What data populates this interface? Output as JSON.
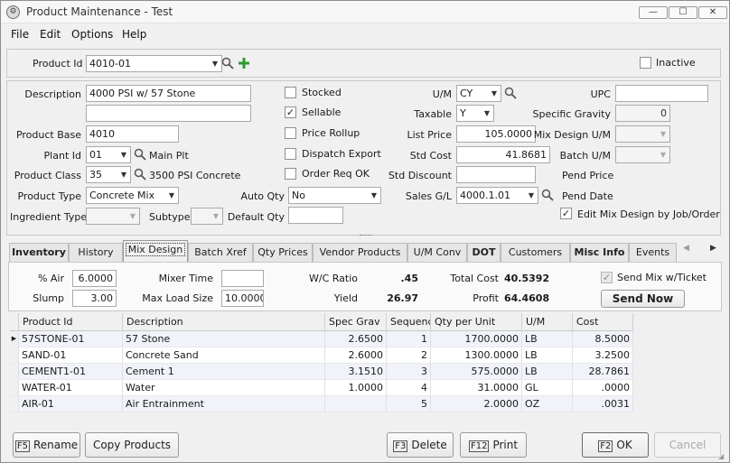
{
  "window": {
    "title": "Product Maintenance - Test",
    "min_glyph": "—",
    "max_glyph": "☐",
    "close_glyph": "✕"
  },
  "menu": [
    "File",
    "Edit",
    "Options",
    "Help"
  ],
  "product_header": {
    "product_id_label": "Product Id",
    "product_id_value": "4010-01",
    "inactive_label": "Inactive",
    "inactive_checked": false
  },
  "details": {
    "description_label": "Description",
    "description_value": "4000 PSI w/ 57 Stone",
    "description2_value": "",
    "product_base_label": "Product Base",
    "product_base_value": "4010",
    "plant_id_label": "Plant Id",
    "plant_id_value": "01",
    "plant_name": "Main Plt",
    "product_class_label": "Product Class",
    "product_class_value": "35",
    "product_class_name": "3500 PSI Concrete",
    "product_type_label": "Product Type",
    "product_type_value": "Concrete Mix",
    "ingredient_type_label": "Ingredient Type",
    "ingredient_type_value": "",
    "subtype_label": "Subtype",
    "subtype_value": "",
    "auto_qty_label": "Auto Qty",
    "auto_qty_value": "No",
    "default_qty_label": "Default Qty",
    "default_qty_value": ""
  },
  "flags": {
    "stocked_label": "Stocked",
    "stocked": false,
    "sellable_label": "Sellable",
    "sellable": true,
    "price_rollup_label": "Price Rollup",
    "price_rollup": false,
    "dispatch_export_label": "Dispatch Export",
    "dispatch_export": false,
    "order_req_ok_label": "Order Req OK",
    "order_req_ok": false
  },
  "pricing": {
    "um_label": "U/M",
    "um_value": "CY",
    "taxable_label": "Taxable",
    "taxable_value": "Y",
    "list_price_label": "List Price",
    "list_price_value": "105.0000",
    "std_cost_label": "Std Cost",
    "std_cost_value": "41.8681",
    "std_discount_label": "Std Discount",
    "std_discount_value": "",
    "sales_gl_label": "Sales G/L",
    "sales_gl_value": "4000.1.01"
  },
  "right_col": {
    "upc_label": "UPC",
    "upc_value": "",
    "specific_gravity_label": "Specific Gravity",
    "specific_gravity_value": "0",
    "mix_design_um_label": "Mix Design U/M",
    "mix_design_um_value": "",
    "batch_um_label": "Batch U/M",
    "batch_um_value": "",
    "pend_price_label": "Pend Price",
    "pend_date_label": "Pend Date",
    "edit_mix_label": "Edit Mix Design by Job/Order",
    "edit_mix": true
  },
  "tabs": [
    "Inventory",
    "History",
    "Mix Design",
    "Batch Xref",
    "Qty Prices",
    "Vendor Products",
    "U/M Conv",
    "DOT",
    "Customers",
    "Misc Info",
    "Events"
  ],
  "active_tab": "Mix Design",
  "mix": {
    "air_label": "% Air",
    "air_value": "6.0000",
    "slump_label": "Slump",
    "slump_value": "3.00",
    "mixer_time_label": "Mixer Time",
    "mixer_time_value": "",
    "max_load_label": "Max Load Size",
    "max_load_value": "10.0000",
    "wc_ratio_label": "W/C Ratio",
    "wc_ratio_value": ".45",
    "yield_label": "Yield",
    "yield_value": "26.97",
    "total_cost_label": "Total Cost",
    "total_cost_value": "40.5392",
    "profit_label": "Profit",
    "profit_value": "64.4608",
    "send_mix_label": "Send Mix w/Ticket",
    "send_mix": true,
    "send_now_label": "Send Now"
  },
  "grid": {
    "columns": [
      "Product Id",
      "Description",
      "Spec Grav",
      "Sequenc",
      "Qty per Unit",
      "U/M",
      "Cost"
    ],
    "rows": [
      [
        "57STONE-01",
        "57 Stone",
        "2.6500",
        "1",
        "1700.0000",
        "LB",
        "8.5000"
      ],
      [
        "SAND-01",
        "Concrete Sand",
        "2.6000",
        "2",
        "1300.0000",
        "LB",
        "3.2500"
      ],
      [
        "CEMENT1-01",
        "Cement 1",
        "3.1510",
        "3",
        "575.0000",
        "LB",
        "28.7861"
      ],
      [
        "WATER-01",
        "Water",
        "1.0000",
        "4",
        "31.0000",
        "GL",
        ".0000"
      ],
      [
        "AIR-01",
        "Air Entrainment",
        "",
        "5",
        "2.0000",
        "OZ",
        ".0031"
      ]
    ]
  },
  "buttons": {
    "rename_key": "F5",
    "rename_label": "Rename",
    "copy_label": "Copy Products",
    "delete_key": "F3",
    "delete_label": "Delete",
    "print_key": "F12",
    "print_label": "Print",
    "ok_key": "F2",
    "ok_label": "OK",
    "cancel_label": "Cancel"
  },
  "colors": {
    "accent_green": "#2e9a2e",
    "selected_tab_border": "#7a7a7a"
  }
}
